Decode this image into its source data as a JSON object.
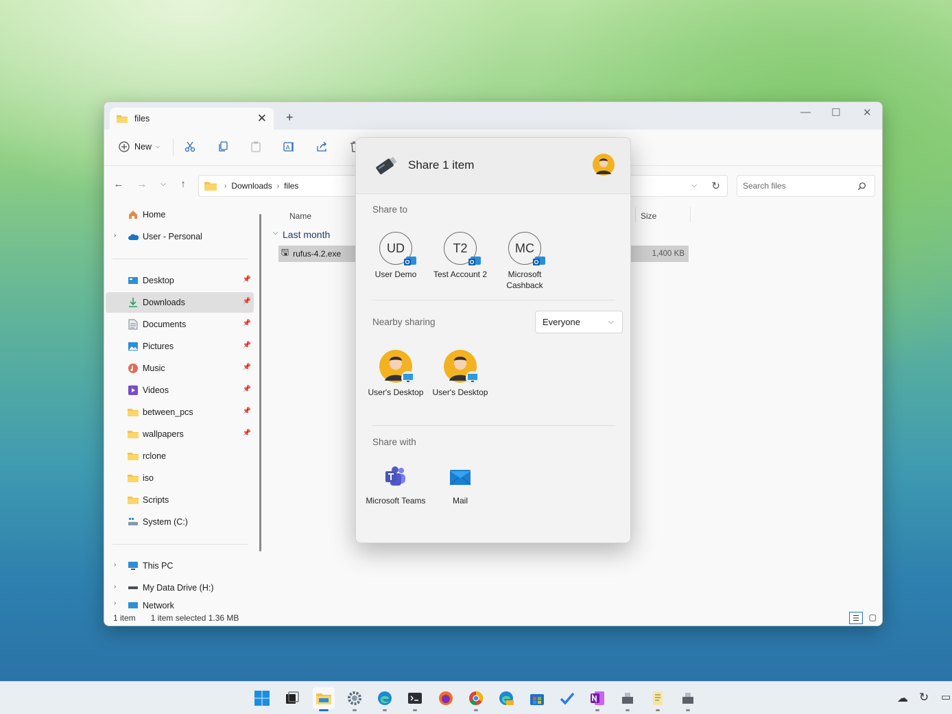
{
  "window": {
    "tab_title": "files",
    "new_tab": "+",
    "close_tab": "✕",
    "controls": [
      "—",
      "☐",
      "✕"
    ]
  },
  "toolbar": {
    "new_label": "New",
    "buttons": [
      "cut-icon",
      "copy-icon",
      "paste-icon",
      "rename-icon",
      "share-icon",
      "delete-icon"
    ]
  },
  "address": {
    "crumbs": [
      "Downloads",
      "files"
    ],
    "search_placeholder": "Search files"
  },
  "sidebar": {
    "top": [
      {
        "label": "Home",
        "icon": "home-icon"
      },
      {
        "label": "User - Personal",
        "icon": "onedrive-icon"
      }
    ],
    "pinned": [
      {
        "label": "Desktop",
        "icon": "desktop-icon"
      },
      {
        "label": "Downloads",
        "icon": "downloads-icon"
      },
      {
        "label": "Documents",
        "icon": "documents-icon"
      },
      {
        "label": "Pictures",
        "icon": "pictures-icon"
      },
      {
        "label": "Music",
        "icon": "music-icon"
      },
      {
        "label": "Videos",
        "icon": "videos-icon"
      },
      {
        "label": "between_pcs",
        "icon": "folder-icon"
      },
      {
        "label": "wallpapers",
        "icon": "folder-icon"
      },
      {
        "label": "rclone",
        "icon": "folder-icon"
      },
      {
        "label": "iso",
        "icon": "folder-icon"
      },
      {
        "label": "Scripts",
        "icon": "folder-icon"
      },
      {
        "label": "System (C:)",
        "icon": "drive-icon"
      }
    ],
    "bottom": [
      {
        "label": "This PC",
        "icon": "pc-icon"
      },
      {
        "label": "My Data Drive (H:)",
        "icon": "drive-icon"
      },
      {
        "label": "Network",
        "icon": "network-icon"
      }
    ]
  },
  "content": {
    "col_name": "Name",
    "col_size": "Size",
    "group": "Last month",
    "file_name": "rufus-4.2.exe",
    "file_size": "1,400 KB"
  },
  "status": {
    "count": "1 item",
    "selected": "1 item selected  1.36 MB"
  },
  "share": {
    "title": "Share 1 item",
    "share_to_label": "Share to",
    "contacts": [
      {
        "initials": "UD",
        "name": "User Demo"
      },
      {
        "initials": "T2",
        "name": "Test Account 2"
      },
      {
        "initials": "MC",
        "name": "Microsoft Cashback"
      }
    ],
    "nearby_label": "Nearby sharing",
    "nearby_option": "Everyone",
    "devices": [
      {
        "name": "User's Desktop"
      },
      {
        "name": "User's Desktop"
      }
    ],
    "share_with_label": "Share with",
    "apps": [
      {
        "name": "Microsoft Teams",
        "icon": "teams-icon"
      },
      {
        "name": "Mail",
        "icon": "mail-icon"
      }
    ]
  },
  "colors": {
    "accent": "#1a73c8",
    "folder": "#f4c24b"
  }
}
